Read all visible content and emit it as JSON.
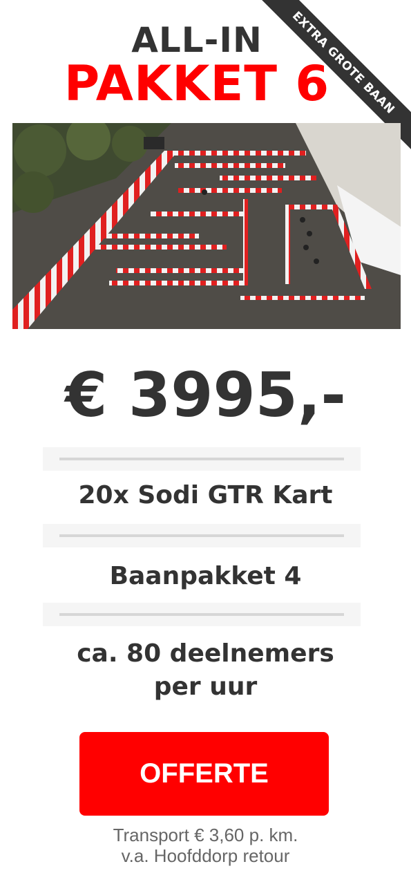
{
  "ribbon": {
    "text": "EXTRA GROTE BAAN"
  },
  "heading": {
    "line1": "ALL-IN",
    "line2": "PAKKET 6"
  },
  "price": "€ 3995,-",
  "features": [
    "20x Sodi GTR Kart",
    "Baanpakket 4",
    "ca. 80 deelnemers",
    "per uur"
  ],
  "cta": {
    "label": "OFFERTE"
  },
  "transport_note": {
    "line1": "Transport € 3,60 p. km.",
    "line2": "v.a. Hoofddorp retour"
  },
  "colors": {
    "accent_red": "#ff0000",
    "text_dark": "#333333",
    "divider_bg": "#f5f5f5",
    "divider_line": "#d6d6d6"
  }
}
